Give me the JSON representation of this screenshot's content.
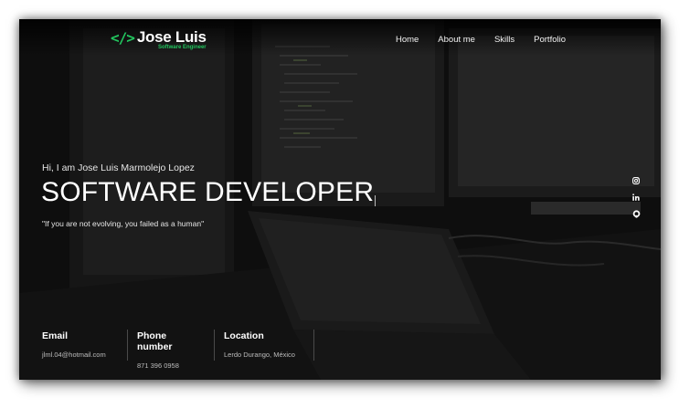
{
  "header": {
    "logo_symbol": "</>",
    "logo_name": "Jose Luis",
    "logo_subtitle": "Software Engineer",
    "nav": [
      {
        "label": "Home"
      },
      {
        "label": "About me"
      },
      {
        "label": "Skills"
      },
      {
        "label": "Portfolio"
      }
    ]
  },
  "hero": {
    "greeting": "Hi, I am Jose Luis Marmolejo Lopez",
    "headline": "SOFTWARE DEVELOPER",
    "quote": "\"If you are not evolving, you failed as a human\""
  },
  "social": [
    {
      "icon": "instagram-icon"
    },
    {
      "icon": "linkedin-icon"
    },
    {
      "icon": "github-icon"
    }
  ],
  "contact": [
    {
      "label": "Email",
      "value": "jlml.04@hotmail.com"
    },
    {
      "label": "Phone number",
      "value": "871 396 0958"
    },
    {
      "label": "Location",
      "value": "Lerdo Durango, México"
    }
  ],
  "colors": {
    "accent": "#22c55e",
    "background": "#0d0d0d",
    "text": "#ffffff"
  }
}
